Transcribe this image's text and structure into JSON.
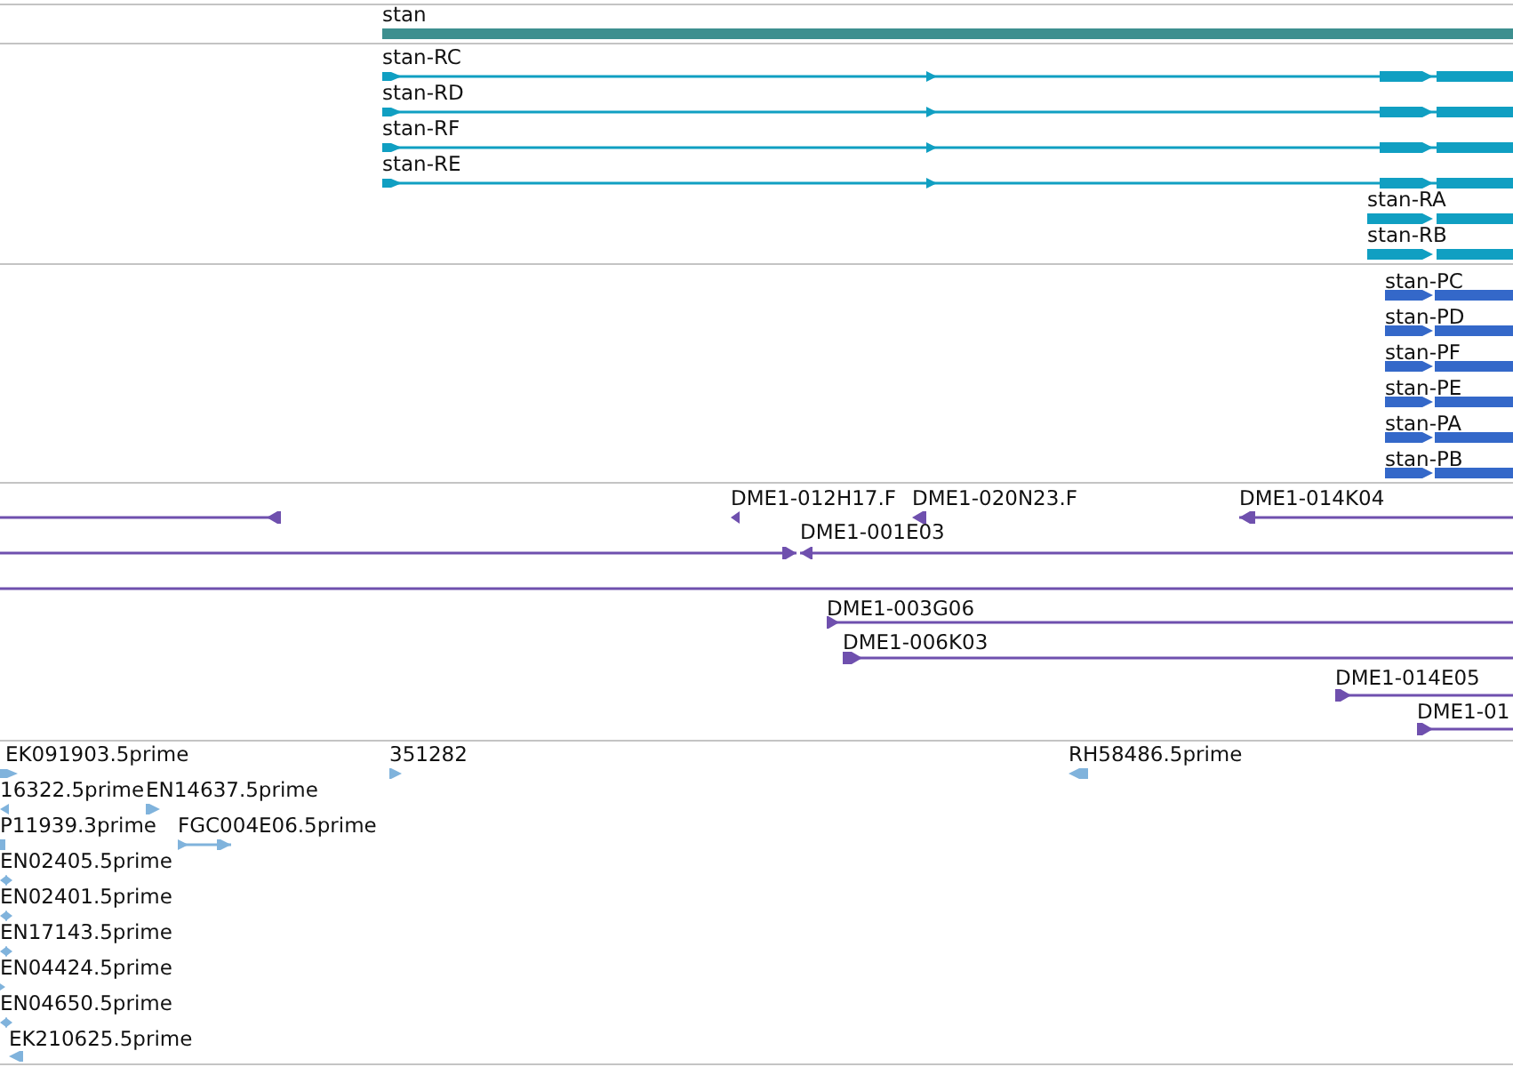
{
  "tracks": [
    {
      "kind": "gene",
      "features": [
        {
          "label": "stan"
        }
      ]
    },
    {
      "kind": "transcript",
      "features": [
        {
          "label": "stan-RC"
        },
        {
          "label": "stan-RD"
        },
        {
          "label": "stan-RF"
        },
        {
          "label": "stan-RE"
        },
        {
          "label": "stan-RA"
        },
        {
          "label": "stan-RB"
        }
      ]
    },
    {
      "kind": "protein",
      "features": [
        {
          "label": "stan-PC"
        },
        {
          "label": "stan-PD"
        },
        {
          "label": "stan-PF"
        },
        {
          "label": "stan-PE"
        },
        {
          "label": "stan-PA"
        },
        {
          "label": "stan-PB"
        }
      ]
    },
    {
      "kind": "clone",
      "features": [
        {
          "label": "DME1-012H17.F"
        },
        {
          "label": "DME1-020N23.F"
        },
        {
          "label": "DME1-014K04"
        },
        {
          "label": "DME1-001E03"
        },
        {
          "label": "DME1-003G06"
        },
        {
          "label": "DME1-006K03"
        },
        {
          "label": "DME1-014E05"
        },
        {
          "label": "DME1-01"
        }
      ]
    },
    {
      "kind": "est",
      "features": [
        {
          "label": "EK091903.5prime"
        },
        {
          "label": "351282"
        },
        {
          "label": "RH58486.5prime"
        },
        {
          "label": "16322.5prime"
        },
        {
          "label": "EN14637.5prime"
        },
        {
          "label": "P11939.3prime"
        },
        {
          "label": "FGC004E06.5prime"
        },
        {
          "label": "EN02405.5prime"
        },
        {
          "label": "EN02401.5prime"
        },
        {
          "label": "EN17143.5prime"
        },
        {
          "label": "EN04424.5prime"
        },
        {
          "label": "EN04650.5prime"
        },
        {
          "label": "EK210625.5prime"
        }
      ]
    }
  ]
}
